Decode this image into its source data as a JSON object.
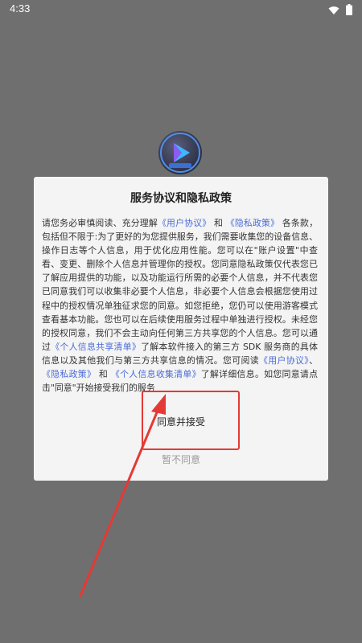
{
  "status_bar": {
    "time": "4:33",
    "icons": [
      "wifi-icon",
      "battery-icon"
    ]
  },
  "app": {
    "logo_icon": "video-play-logo"
  },
  "dialog": {
    "title": "服务协议和隐私政策",
    "body": {
      "p1": "请您务必审慎阅读、充分理解",
      "link_user_agreement_1": "《用户协议》",
      "and_1": "和",
      "link_privacy_1": "《隐私政策》",
      "p2": "各条款，包括但不限于:为了更好的为您提供服务，我们需要收集您的设备信息、操作日志等个人信息，用于优化应用性能。您可以在\"账户设置\"中查看、变更、删除个人信息并管理你的授权。您同意隐私政策仅代表您已了解应用提供的功能，以及功能运行所需的必要个人信息，并不代表您已同意我们可以收集非必要个人信息，非必要个人信息会根据您使用过程中的授权情况单独征求您的同意。如您拒绝，您仍可以使用游客模式查看基本功能。您也可以在后续使用服务过程中单独进行授权。未经您的授权同意，我们不会主动向任何第三方共享您的个人信息。您可以通过",
      "link_share_list": "《个人信息共享清单》",
      "p3": "了解本软件接入的第三方 SDK 服务商的具体信息以及其他我们与第三方共享信息的情况。您可阅读",
      "link_user_agreement_2": "《用户协议》",
      "sep": "、",
      "link_privacy_2": "《隐私政策》",
      "and_2": "和",
      "link_collect_list": "《个人信息收集清单》",
      "p4": "了解详细信息。如您同意请点击\"同意\"开始接受我们的服务"
    },
    "agree_label": "同意并接受",
    "decline_label": "暂不同意"
  },
  "colors": {
    "link": "#4a6bd8",
    "overlay_background": "#6f6f6f",
    "annotation": "#e53935"
  }
}
